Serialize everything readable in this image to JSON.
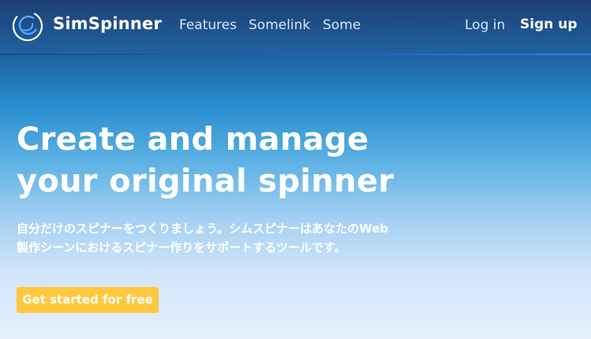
{
  "colors": {
    "accent": "#ffc83d",
    "nav_link": "#d7e6f7",
    "heading": "#ffffff"
  },
  "header": {
    "logo_icon": "spinner-swirl-icon",
    "brand": "SimSpinner",
    "links": [
      "Features",
      "Somelink",
      "Some"
    ],
    "login": "Log in",
    "signup": "Sign up"
  },
  "hero": {
    "title_lines": [
      "Create and manage",
      "your original spinner"
    ],
    "description_lines": [
      "自分だけのスピナーをつくりましょう。シムスピナーはあなたのWeb",
      "製作シーンにおけるスピナー作りをサポートするツールです。"
    ],
    "cta_label": "Get started for free"
  }
}
